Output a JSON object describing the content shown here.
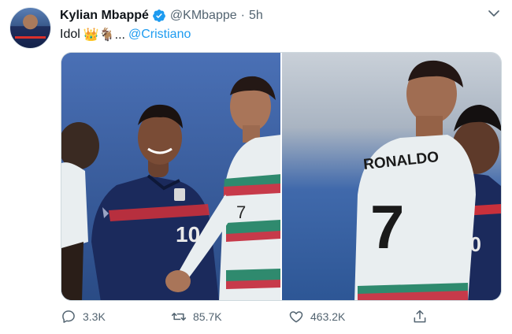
{
  "tweet": {
    "author_name": "Kylian Mbappé",
    "handle": "@KMbappe",
    "separator": "·",
    "time": "5h",
    "text": "Idol",
    "emojis": "👑🐐...",
    "mention": "@Cristiano"
  },
  "photos": {
    "left_jersey_number": "10",
    "left_ronaldo_number": "7",
    "right_jersey_name": "RONALDO",
    "right_jersey_number": "7",
    "right_mbappe_number": "10"
  },
  "actions": {
    "replies": "3.3K",
    "retweets": "85.7K",
    "likes": "463.2K"
  },
  "icons": {
    "verified": "verified-badge-icon",
    "caret": "chevron-down-icon",
    "reply": "reply-icon",
    "retweet": "retweet-icon",
    "like": "heart-icon",
    "share": "share-icon"
  },
  "colors": {
    "accent": "#1d9bf0",
    "muted": "#536471",
    "france_blue": "#1b2a5c",
    "portugal_white": "#e9eef0"
  }
}
